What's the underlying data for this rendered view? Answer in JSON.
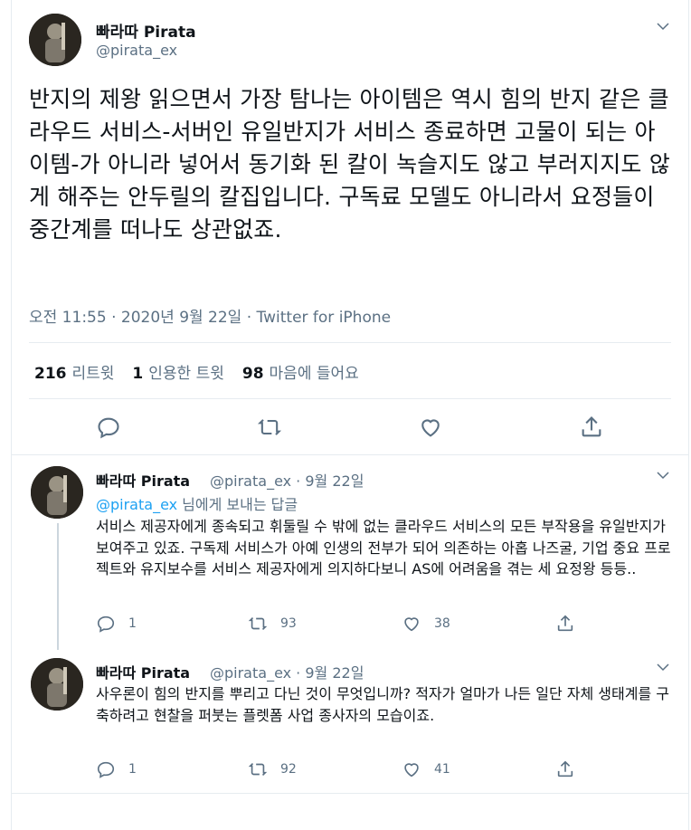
{
  "main_tweet": {
    "display_name": "빠라따 Pirata",
    "handle": "@pirata_ex",
    "text": "반지의 제왕 읽으면서 가장 탐나는 아이템은 역시 힘의 반지 같은 클라우드 서비스-서버인 유일반지가 서비스 종료하면 고물이 되는 아이템-가 아니라 넣어서 동기화 된 칼이 녹슬지도 않고 부러지지도 않게 해주는 안두릴의 칼집입니다. 구독료 모델도 아니라서 요정들이 중간계를 떠나도 상관없죠.",
    "meta": "오전 11:55 · 2020년 9월 22일 · Twitter for iPhone",
    "retweets_count": "216",
    "retweets_label": "리트윗",
    "quotes_count": "1",
    "quotes_label": "인용한 트윗",
    "likes_count": "98",
    "likes_label": "마음에 들어요"
  },
  "replies": [
    {
      "display_name": "빠라따 Pirata",
      "handle_date": "@pirata_ex · 9월 22일",
      "reply_to_mention": "@pirata_ex",
      "reply_to_suffix": " 님에게 보내는 답글",
      "text": "서비스 제공자에게 종속되고 휘둘릴 수 밖에 없는 클라우드 서비스의 모든 부작용을 유일반지가 보여주고 있죠. 구독제 서비스가 아예 인생의 전부가 되어 의존하는 아홉 나즈굴, 기업 중요 프로젝트와 유지보수를 서비스 제공자에게 의지하다보니 AS에 어려움을 겪는 세 요정왕 등등..",
      "replies": "1",
      "retweets": "93",
      "likes": "38"
    },
    {
      "display_name": "빠라따 Pirata",
      "handle_date": "@pirata_ex · 9월 22일",
      "text": "사우론이 힘의 반지를 뿌리고 다닌 것이 무엇입니까? 적자가 얼마가 나든 일단 자체 생태계를 구축하려고 현찰을 퍼붓는 플렛폼 사업 종사자의 모습이죠.",
      "replies": "1",
      "retweets": "92",
      "likes": "41"
    }
  ],
  "colors": {
    "accent": "#1da1f2",
    "secondary_text": "#5b7083",
    "divider": "#e6ecf0"
  }
}
